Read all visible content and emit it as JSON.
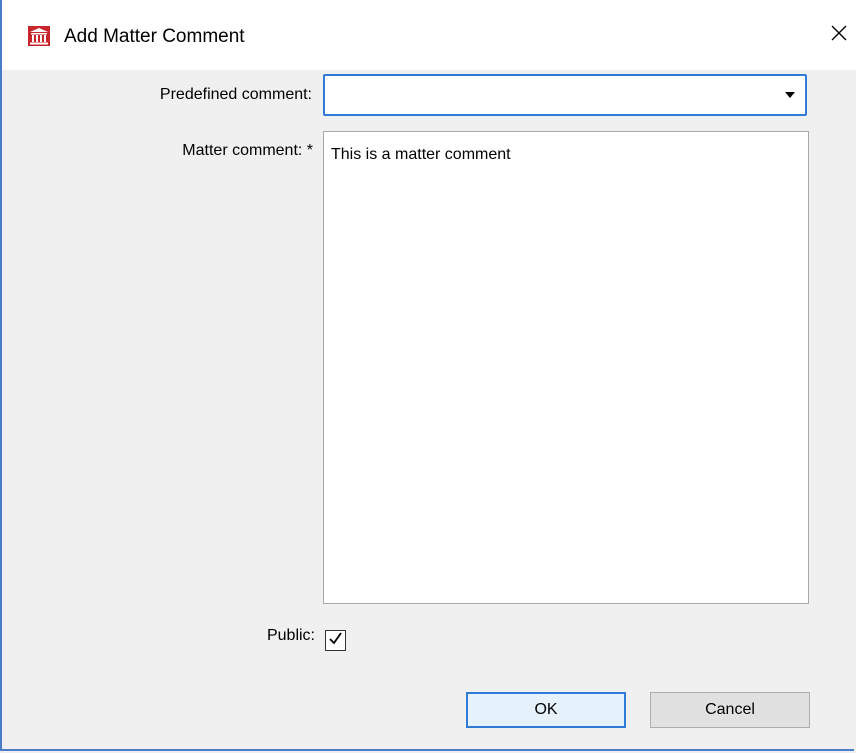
{
  "window": {
    "title": "Add Matter Comment",
    "icon": "courthouse-icon",
    "close_icon": "close-icon"
  },
  "form": {
    "predefined_comment": {
      "label": "Predefined comment:",
      "value": ""
    },
    "matter_comment": {
      "label": "Matter comment: *",
      "value": "This is a matter comment"
    },
    "public": {
      "label": "Public:",
      "checked": true
    }
  },
  "buttons": {
    "ok": "OK",
    "cancel": "Cancel"
  },
  "colors": {
    "accent": "#2f7bd6",
    "icon_red": "#c8262c",
    "background": "#f0f0f0"
  }
}
